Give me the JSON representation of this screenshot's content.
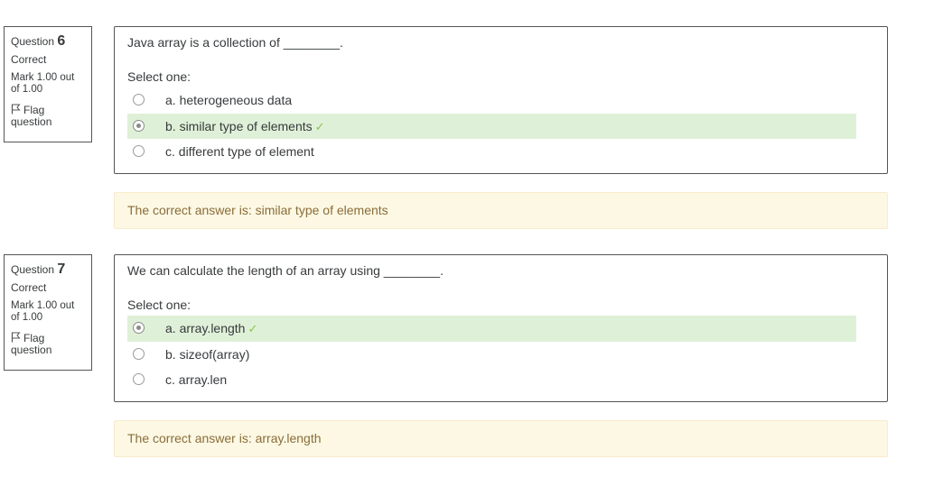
{
  "questions": [
    {
      "label": "Question",
      "number": "6",
      "state": "Correct",
      "grade": "Mark 1.00 out of 1.00",
      "flag": "Flag question",
      "text": "Java array is a collection of ________.",
      "prompt": "Select one:",
      "options": [
        {
          "label": "a. heterogeneous data",
          "checked": false,
          "correct": false
        },
        {
          "label": "b. similar type of elements",
          "checked": true,
          "correct": true
        },
        {
          "label": "c. different type of element",
          "checked": false,
          "correct": false
        }
      ],
      "feedback": "The correct answer is: similar type of elements"
    },
    {
      "label": "Question",
      "number": "7",
      "state": "Correct",
      "grade": "Mark 1.00 out of 1.00",
      "flag": "Flag question",
      "text": "We can calculate the length of an array using ________.",
      "prompt": "Select one:",
      "options": [
        {
          "label": "a. array.length",
          "checked": true,
          "correct": true
        },
        {
          "label": "b. sizeof(array)",
          "checked": false,
          "correct": false
        },
        {
          "label": "c. array.len",
          "checked": false,
          "correct": false
        }
      ],
      "feedback": "The correct answer is: array.length"
    }
  ],
  "colors": {
    "correct_bg": "#dff0d8",
    "feedback_bg": "#fcf8e3",
    "feedback_text": "#8a6d3b",
    "tick": "#8bc34a"
  },
  "icons": {
    "flag": "flag-icon",
    "correct": "check-icon"
  }
}
